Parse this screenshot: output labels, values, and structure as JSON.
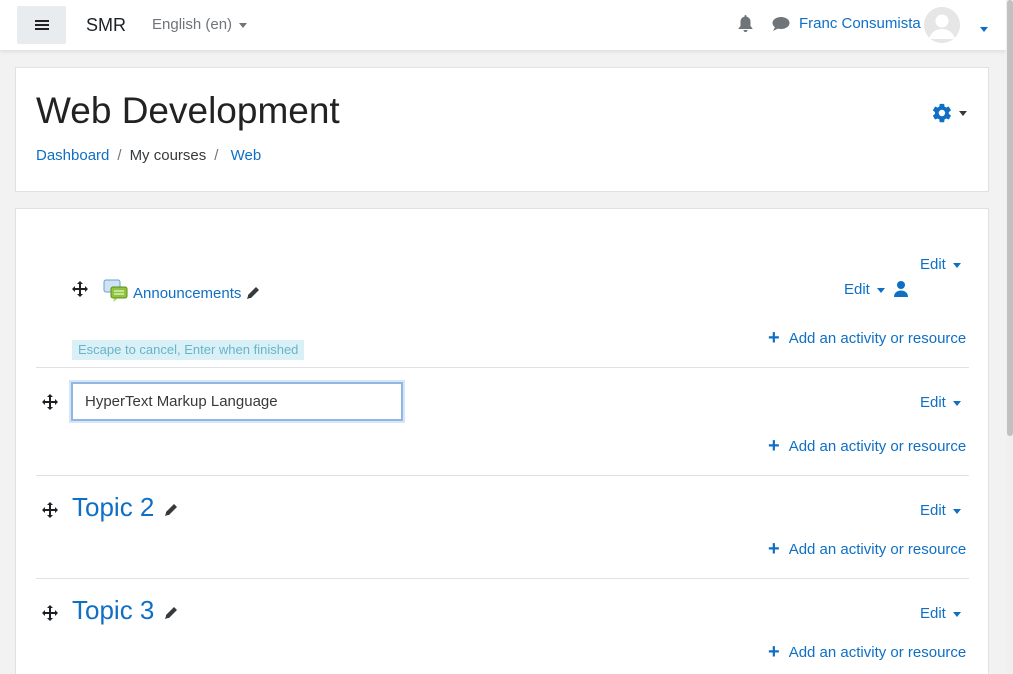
{
  "navbar": {
    "brand": "SMR",
    "language": "English (en)",
    "user_name": "Franc Consumista"
  },
  "header": {
    "title": "Web Development",
    "breadcrumb": [
      "Dashboard",
      "My courses",
      "Web"
    ]
  },
  "course": {
    "section0": {
      "edit_label": "Edit",
      "activity": {
        "name": "Announcements",
        "edit_label": "Edit"
      },
      "hint": "Escape to cancel, Enter when finished",
      "add_label": "Add an activity or resource"
    },
    "section1": {
      "input_value": "HyperText Markup Language",
      "edit_label": "Edit",
      "add_label": "Add an activity or resource"
    },
    "section2": {
      "title": "Topic 2",
      "edit_label": "Edit",
      "add_label": "Add an activity or resource"
    },
    "section3": {
      "title": "Topic 3",
      "edit_label": "Edit",
      "add_label": "Add an activity or resource"
    }
  },
  "colors": {
    "link": "#0f6fc5",
    "background": "#f2f2f2",
    "hint_bg": "#d9f0f7"
  },
  "icons": [
    "hamburger-icon",
    "bell-icon",
    "chat-icon",
    "avatar-icon",
    "gear-icon",
    "move-icon",
    "pencil-icon",
    "forum-icon",
    "user-icon",
    "plus-icon"
  ]
}
